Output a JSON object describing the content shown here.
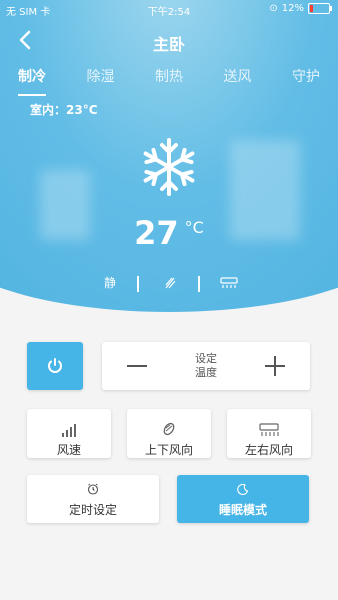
{
  "status": {
    "carrier": "无 SIM 卡",
    "time": "下午2:54",
    "battery": "12%"
  },
  "header": {
    "title": "主卧"
  },
  "tabs": [
    {
      "label": "制冷",
      "active": true
    },
    {
      "label": "除湿",
      "active": false
    },
    {
      "label": "制热",
      "active": false
    },
    {
      "label": "送风",
      "active": false
    },
    {
      "label": "守护",
      "active": false
    }
  ],
  "indoor": "室内：23°C",
  "temperature": {
    "value": "27",
    "unit": "°C"
  },
  "modes": {
    "quiet": "静"
  },
  "controls": {
    "set_temp_label_1": "设定",
    "set_temp_label_2": "温度",
    "fan_speed": "风速",
    "vertical_swing": "上下风向",
    "horizontal_swing": "左右风向",
    "timer": "定时设定",
    "sleep": "睡眠模式"
  },
  "colors": {
    "accent": "#45b4e6",
    "battery_low": "#ff3b30"
  }
}
